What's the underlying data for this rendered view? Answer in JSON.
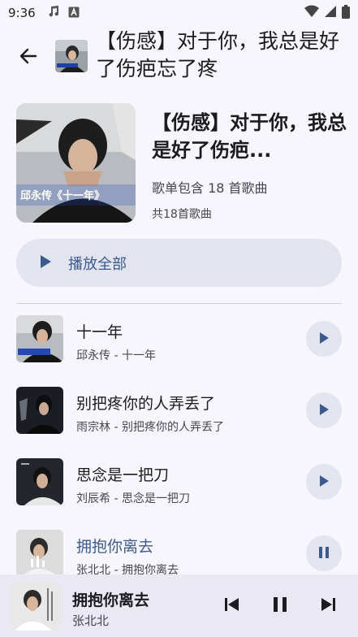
{
  "status_bar": {
    "time": "9:36",
    "left_icons": [
      "music-note-icon",
      "text-a-icon"
    ],
    "right_icons": [
      "wifi-icon",
      "signal-icon",
      "battery-icon"
    ]
  },
  "topbar": {
    "back_icon": "arrow-left-icon",
    "title": "【伤感】对于你，我总是好了伤疤忘了疼"
  },
  "playlist": {
    "title": "【伤感】对于你，我总是好了伤疤...",
    "description": "歌单包含 18 首歌曲",
    "count": "共18首歌曲",
    "cover_caption": "邱永传《十一年》"
  },
  "play_all": {
    "label": "播放全部",
    "icon": "play-icon"
  },
  "songs": [
    {
      "title": "十一年",
      "subtitle": "邱永传 - 十一年",
      "action_icon": "play-icon",
      "active": false
    },
    {
      "title": "别把疼你的人弄丢了",
      "subtitle": "雨宗林 - 别把疼你的人弄丢了",
      "action_icon": "play-icon",
      "active": false
    },
    {
      "title": "思念是一把刀",
      "subtitle": "刘辰希 - 思念是一把刀",
      "action_icon": "play-icon",
      "active": false
    },
    {
      "title": "拥抱你离去",
      "subtitle": "张北北 - 拥抱你离去",
      "action_icon": "pause-icon",
      "active": true
    }
  ],
  "mini_player": {
    "title": "拥抱你离去",
    "artist": "张北北",
    "controls": [
      "skip-previous-icon",
      "pause-icon",
      "skip-next-icon"
    ]
  },
  "colors": {
    "background": "#f7f6fc",
    "accent": "#3d5a8c",
    "chip": "#e2e4f0",
    "mini_player": "#eae9f3"
  }
}
